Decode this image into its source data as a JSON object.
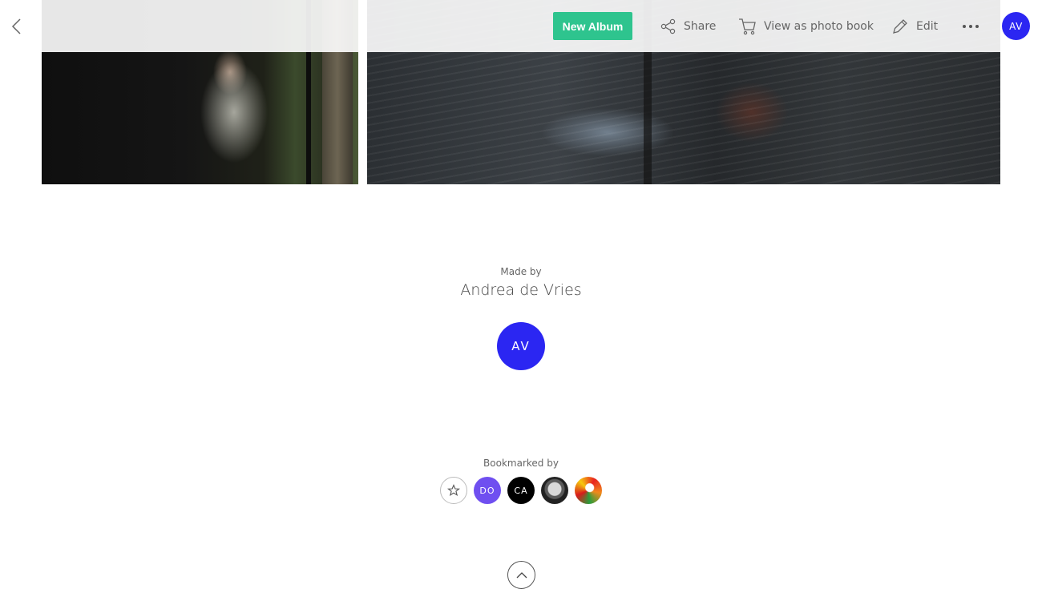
{
  "toolbar": {
    "new_album_label": "New Album",
    "share_label": "Share",
    "photo_book_label": "View as photo book",
    "edit_label": "Edit",
    "user_initials": "AV",
    "accent_color": "#2ec48e",
    "avatar_color": "#2b26f2"
  },
  "credits": {
    "made_by_label": "Made by",
    "author_name": "Andrea de Vries",
    "author_initials": "AV"
  },
  "bookmarks": {
    "label": "Bookmarked by",
    "users": [
      {
        "initials": "DO",
        "color": "#6f4ff0"
      },
      {
        "initials": "CA",
        "color": "#000000"
      },
      {
        "initials": "",
        "kind": "photo"
      },
      {
        "initials": "",
        "kind": "photo"
      }
    ]
  },
  "icons": [
    "back-arrow-icon",
    "share-icon",
    "cart-icon",
    "pencil-icon",
    "more-dots-icon",
    "star-icon",
    "chevron-up-icon"
  ]
}
